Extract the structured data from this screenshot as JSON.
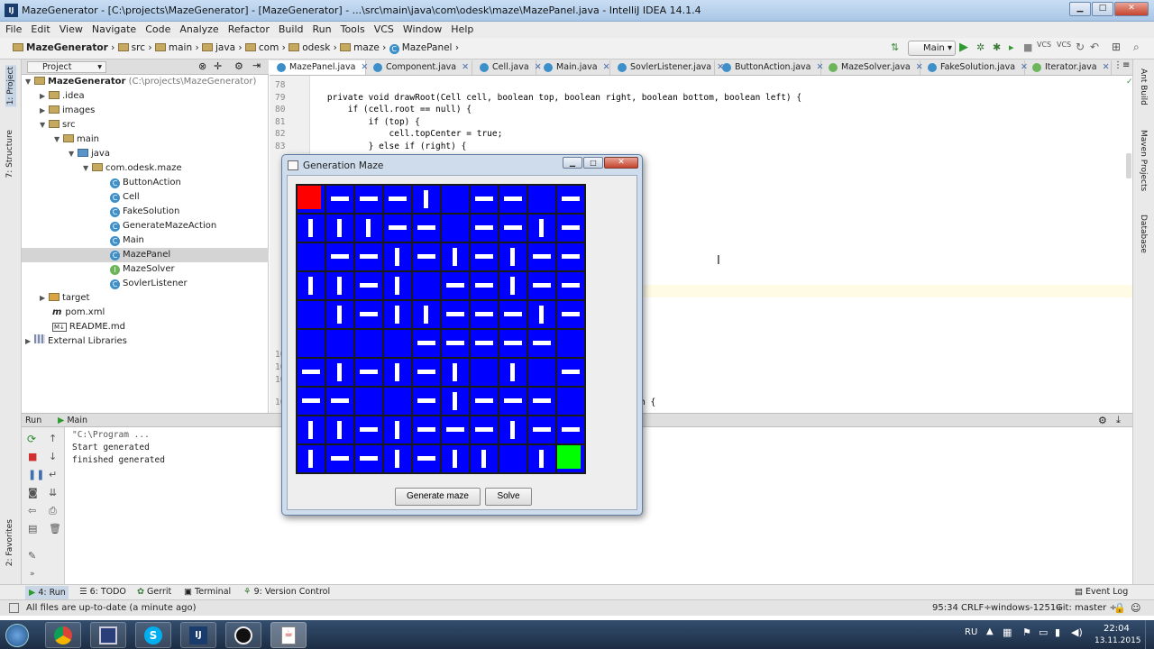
{
  "window": {
    "title": "MazeGenerator - [C:\\projects\\MazeGenerator] - [MazeGenerator] - ...\\src\\main\\java\\com\\odesk\\maze\\MazePanel.java - IntelliJ IDEA 14.1.4"
  },
  "menu": [
    "File",
    "Edit",
    "View",
    "Navigate",
    "Code",
    "Analyze",
    "Refactor",
    "Build",
    "Run",
    "Tools",
    "VCS",
    "Window",
    "Help"
  ],
  "breadcrumbs": [
    "MazeGenerator",
    "src",
    "main",
    "java",
    "com",
    "odesk",
    "maze",
    "MazePanel"
  ],
  "run_config": "Main",
  "project_panel": {
    "header": "Project",
    "root": "MazeGenerator",
    "root_path": "(C:\\projects\\MazeGenerator)",
    "items": [
      ".idea",
      "images",
      "src",
      "main",
      "java",
      "com.odesk.maze",
      "ButtonAction",
      "Cell",
      "FakeSolution",
      "GenerateMazeAction",
      "Main",
      "MazePanel",
      "MazeSolver",
      "SovlerListener",
      "target",
      "pom.xml",
      "README.md",
      "External Libraries"
    ]
  },
  "left_tabs": [
    "1: Project",
    "7: Structure",
    "2: Favorites"
  ],
  "right_tabs": [
    "Ant Build",
    "Maven Projects",
    "Database"
  ],
  "editor_tabs": [
    "MazePanel.java",
    "Component.java",
    "Cell.java",
    "Main.java",
    "SovlerListener.java",
    "ButtonAction.java",
    "MazeSolver.java",
    "FakeSolution.java",
    "Iterator.java"
  ],
  "code": {
    "lines": [
      {
        "n": "78",
        "t": ""
      },
      {
        "n": "79",
        "t": "    private void drawRoot(Cell cell, boolean top, boolean right, boolean bottom, boolean left) {"
      },
      {
        "n": "80",
        "t": "        if (cell.root == null) {"
      },
      {
        "n": "81",
        "t": "            if (top) {"
      },
      {
        "n": "82",
        "t": "                cell.topCenter = true;"
      },
      {
        "n": "83",
        "t": "            } else if (right) {"
      }
    ],
    "hidden_numbers": [
      "10",
      "10",
      "10",
      "10"
    ],
    "fragment": "n {"
  },
  "run_panel": {
    "header_run": "Run",
    "header_config": "Main",
    "console": [
      "\"C:\\Program ...",
      "Start generated",
      "finished generated"
    ]
  },
  "dialog": {
    "title": "Generation Maze",
    "generate_label": "Generate maze",
    "solve_label": "Solve"
  },
  "bottom_tabs": [
    "4: Run",
    "6: TODO",
    "Gerrit",
    "Terminal",
    "9: Version Control"
  ],
  "event_log": "Event Log",
  "status": {
    "message": "All files are up-to-date (a minute ago)",
    "position": "95:34",
    "line_sep": "CRLF÷",
    "encoding": "windows-1251÷",
    "git": "Git: master ÷"
  },
  "taskbar": {
    "lang": "RU",
    "time": "22:04",
    "date": "13.11.2015"
  },
  "colors": {
    "maze_path": "#0000ff",
    "maze_wall": "#ffffff",
    "maze_start": "#ff0000",
    "maze_end": "#00ff00"
  }
}
